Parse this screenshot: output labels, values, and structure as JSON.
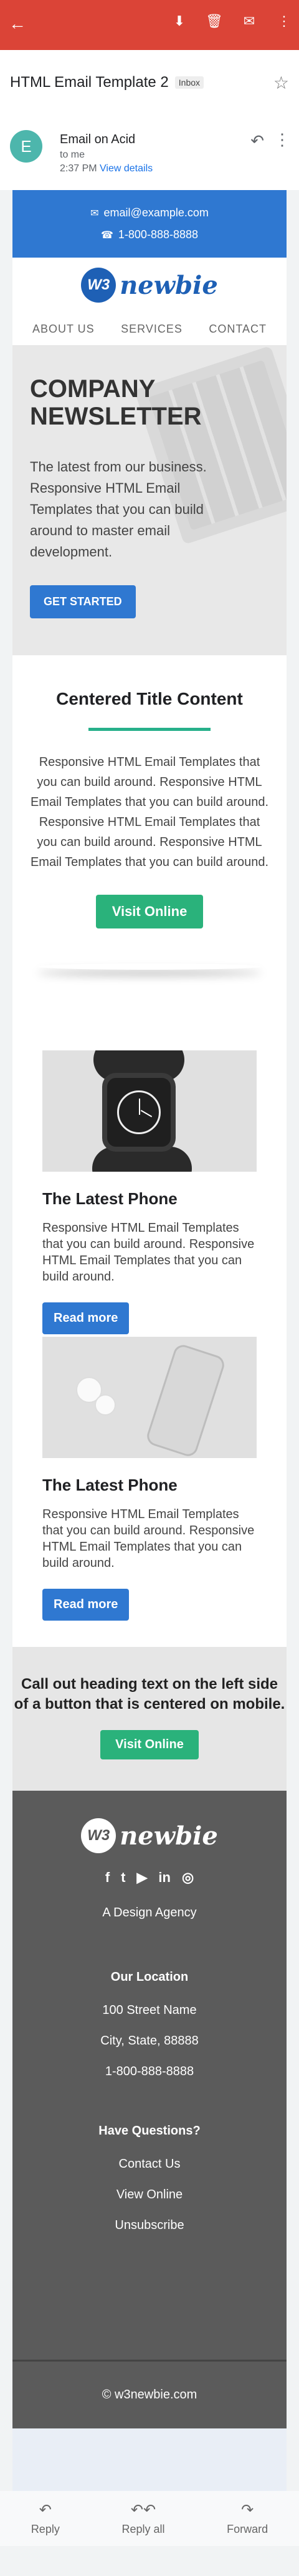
{
  "topbar": {
    "back_icon": "back-arrow-icon",
    "actions": [
      "archive-icon",
      "delete-icon",
      "mail-icon",
      "more-vert-icon"
    ]
  },
  "subject": {
    "title": "HTML Email Template 2",
    "badge": "Inbox"
  },
  "sender": {
    "avatar": "E",
    "name": "Email on Acid",
    "to": "to me",
    "time": "2:37 PM",
    "details_link": "View details"
  },
  "contact": {
    "email": "email@example.com",
    "phone": "1-800-888-8888"
  },
  "brand": {
    "badge": "W3",
    "logo": "newbie"
  },
  "nav": [
    "ABOUT US",
    "SERVICES",
    "CONTACT"
  ],
  "hero": {
    "title": "COMPANY NEWSLETTER",
    "text": "The latest from our business. Responsive HTML Email Templates that you can build around to master email development.",
    "button": "GET STARTED"
  },
  "centered": {
    "title": "Centered Title Content",
    "text": "Responsive HTML Email Templates that you can build around. Responsive HTML Email Templates that you can build around. Responsive HTML Email Templates that you can build around. Responsive HTML Email Templates that you can build around.",
    "button": "Visit Online"
  },
  "cards": [
    {
      "title": "The Latest Phone",
      "text": "Responsive HTML Email Templates that you can build around. Responsive HTML Email Templates that you can build around.",
      "button": "Read more"
    },
    {
      "title": "The Latest Phone",
      "text": "Responsive HTML Email Templates that you can build around. Responsive HTML Email Templates that you can build around.",
      "button": "Read more"
    }
  ],
  "callout": {
    "title": "Call out heading text on the left side of a button that is centered on mobile.",
    "button": "Visit Online"
  },
  "footer": {
    "badge": "W3",
    "logo": "newbie",
    "social": [
      "f",
      "t",
      "▶",
      "in",
      "◎"
    ],
    "agency": "A Design Agency",
    "location_title": "Our Location",
    "address1": "100 Street Name",
    "address2": "City, State, 88888",
    "phone": "1-800-888-8888",
    "questions_title": "Have Questions?",
    "link1": "Contact Us",
    "link2": "View Online",
    "link3": "Unsubscribe",
    "copyright": "© w3newbie.com"
  },
  "bottombar": {
    "reply": "Reply",
    "reply_all": "Reply all",
    "forward": "Forward"
  },
  "colors": {
    "gmail_red": "#db4437",
    "brand_blue": "#2f78d1",
    "accent_green": "#2ab27b",
    "footer_gray": "#5b5b5b"
  }
}
